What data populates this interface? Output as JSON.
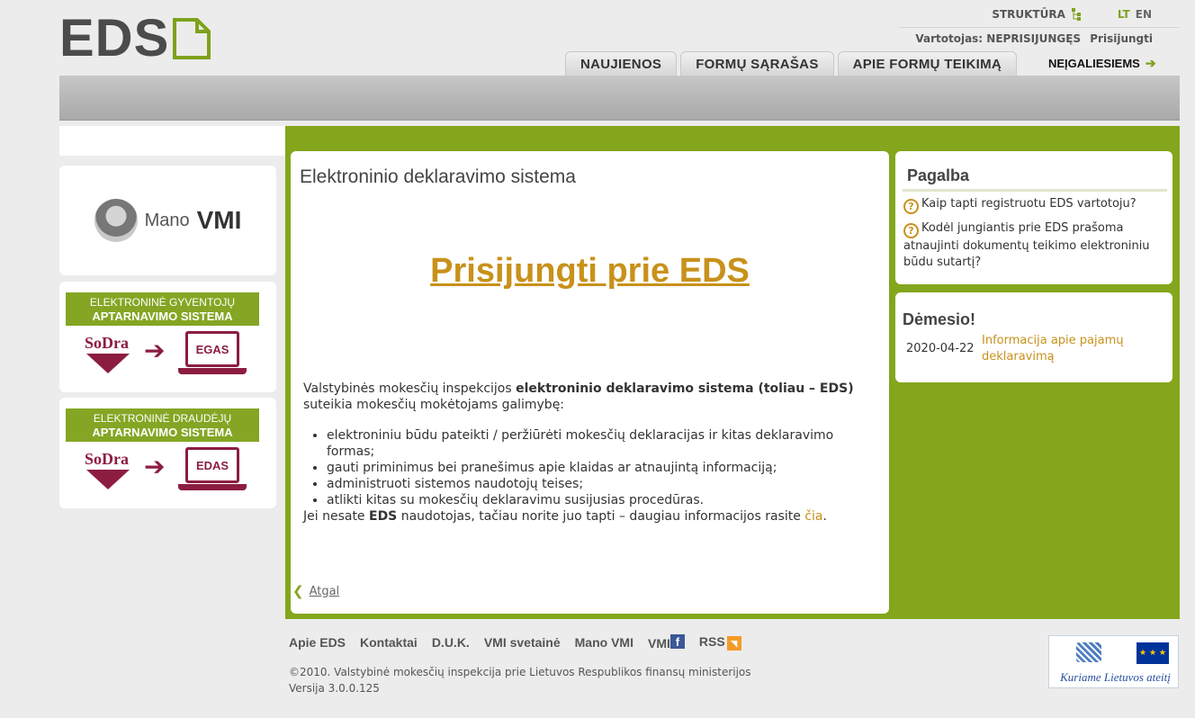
{
  "header": {
    "logo_text": "EDS",
    "structure_label": "STRUKTŪRA",
    "lang_lt": "LT",
    "lang_en": "EN",
    "user_label": "Vartotojas: NEPRISIJUNGĘS",
    "login_link": "Prisijungti",
    "tabs": [
      {
        "label": "NAUJIENOS"
      },
      {
        "label": "FORMŲ SĄRAŠAS"
      },
      {
        "label": "APIE FORMŲ TEIKIMĄ"
      }
    ],
    "accessibility_link": "NEĮGALIESIEMS"
  },
  "left": {
    "mano_vmi_1": "Mano",
    "mano_vmi_2": "VMI",
    "egas": {
      "line1": "ELEKTRONINĖ GYVENTOJŲ",
      "line2": "APTARNAVIMO SISTEMA",
      "brand": "SoDra",
      "system": "EGAS"
    },
    "edas": {
      "line1": "ELEKTRONINĖ DRAUDĖJŲ",
      "line2": "APTARNAVIMO SISTEMA",
      "brand": "SoDra",
      "system": "EDAS"
    }
  },
  "main": {
    "title": "Elektroninio deklaravimo sistema",
    "cta": "Prisijungti prie EDS",
    "intro_prefix": "Valstybinės mokesčių inspekcijos ",
    "intro_bold": "elektroninio deklaravimo sistema (toliau – EDS)",
    "intro_suffix": " suteikia mokesčių mokėtojams galimybę:",
    "bullets": [
      "elektroniniu būdu pateikti / peržiūrėti mokesčių deklaracijas ir kitas deklaravimo formas;",
      "gauti priminimus bei pranešimus apie klaidas ar atnaujintą informaciją;",
      "administruoti sistemos naudotojų teises;",
      "atlikti kitas su mokesčių deklaravimu susijusias procedūras."
    ],
    "outro_prefix": "Jei nesate ",
    "outro_bold": "EDS",
    "outro_suffix": " naudotojas, tačiau norite juo tapti – daugiau informacijos rasite ",
    "outro_link": "čia",
    "outro_end": ".",
    "back_label": "Atgal"
  },
  "help": {
    "title": "Pagalba",
    "questions": [
      "Kaip tapti registruotu EDS vartotoju?",
      "Kodėl jungiantis prie EDS prašoma atnaujinti dokumentų teikimo elektroniniu būdu sutartį?"
    ]
  },
  "attention": {
    "title": "Dėmesio!",
    "date": "2020-04-22",
    "link": "Informacija apie pajamų deklaravimą"
  },
  "footer": {
    "links": [
      "Apie EDS",
      "Kontaktai",
      "D.U.K.",
      "VMI svetainė",
      "Mano VMI",
      "VMI",
      "RSS"
    ],
    "copyright": "©2010. Valstybinė mokesčių inspekcija prie Lietuvos Respublikos finansų ministerijos",
    "version": "Versija 3.0.0.125",
    "eu_slogan": "Kuriame Lietuvos ateitį"
  },
  "colors": {
    "accent_green": "#84a61c",
    "link_gold": "#c8911a",
    "sodra": "#8c1d40"
  }
}
